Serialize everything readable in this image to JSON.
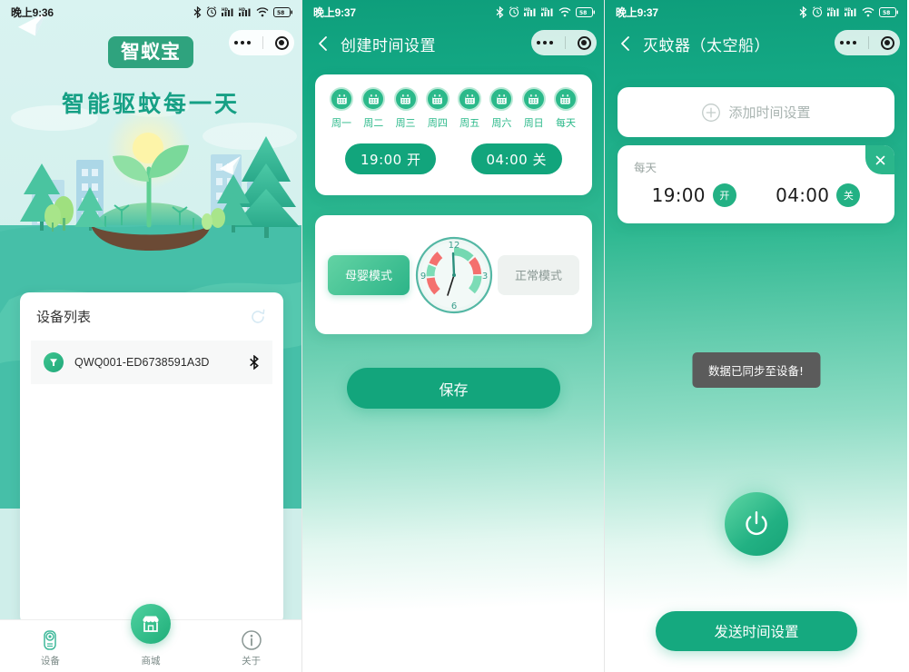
{
  "colors": {
    "brand_green": "#13a57c",
    "brand_green_light": "#2bb98a",
    "accent_mint": "#5ed6a4",
    "toast_bg": "#5b5b5b",
    "inactive_gray": "#eef2f0",
    "clock_red": "#f4706e"
  },
  "panel1": {
    "statusbar": {
      "time": "晚上9:36",
      "battery": "58"
    },
    "capsule": {
      "more_icon": "more-dots-icon",
      "target_icon": "target-icon"
    },
    "logo": "智蚁宝",
    "tagline": "智能驱蚊每一天",
    "device_list": {
      "title": "设备列表",
      "refresh_icon": "refresh-icon",
      "items": [
        {
          "icon": "device-icon",
          "name": "QWQ001-ED6738591A3D",
          "status_icon": "bluetooth-icon"
        }
      ]
    },
    "tabs": [
      {
        "icon": "device-camera-icon",
        "label": "设备",
        "active": false
      },
      {
        "icon": "store-icon",
        "label": "商城",
        "active": true
      },
      {
        "icon": "info-icon",
        "label": "关于",
        "active": false
      }
    ]
  },
  "panel2": {
    "statusbar": {
      "time": "晚上9:37",
      "battery": "58"
    },
    "nav": {
      "back_icon": "chevron-left-icon",
      "title": "创建时间设置"
    },
    "weekdays": [
      {
        "label": "周一",
        "icon": "calendar-icon"
      },
      {
        "label": "周二",
        "icon": "calendar-icon"
      },
      {
        "label": "周三",
        "icon": "calendar-icon"
      },
      {
        "label": "周四",
        "icon": "calendar-icon"
      },
      {
        "label": "周五",
        "icon": "calendar-icon"
      },
      {
        "label": "周六",
        "icon": "calendar-icon"
      },
      {
        "label": "周日",
        "icon": "calendar-icon"
      },
      {
        "label": "每天",
        "icon": "calendar-icon"
      }
    ],
    "time_pills": [
      {
        "value": "19:00 开"
      },
      {
        "value": "04:00 关"
      }
    ],
    "modes": {
      "left": {
        "label": "母婴模式",
        "active": true
      },
      "right": {
        "label": "正常模式",
        "active": false
      }
    },
    "clock": {
      "ticks": [
        "12",
        "3",
        "6",
        "9"
      ]
    },
    "save_label": "保存"
  },
  "panel3": {
    "statusbar": {
      "time": "晚上9:37",
      "battery": "58"
    },
    "nav": {
      "back_icon": "chevron-left-icon",
      "title": "灭蚊器（太空船）"
    },
    "add_schedule": {
      "label": "添加时间设置",
      "icon": "plus-circle-icon"
    },
    "schedule": {
      "day": "每天",
      "close_icon": "close-icon",
      "slots": [
        {
          "time": "19:00",
          "badge": "开"
        },
        {
          "time": "04:00",
          "badge": "关"
        }
      ]
    },
    "toast": "数据已同步至设备!",
    "power_button": {
      "icon": "power-icon"
    },
    "send_label": "发送时间设置"
  }
}
